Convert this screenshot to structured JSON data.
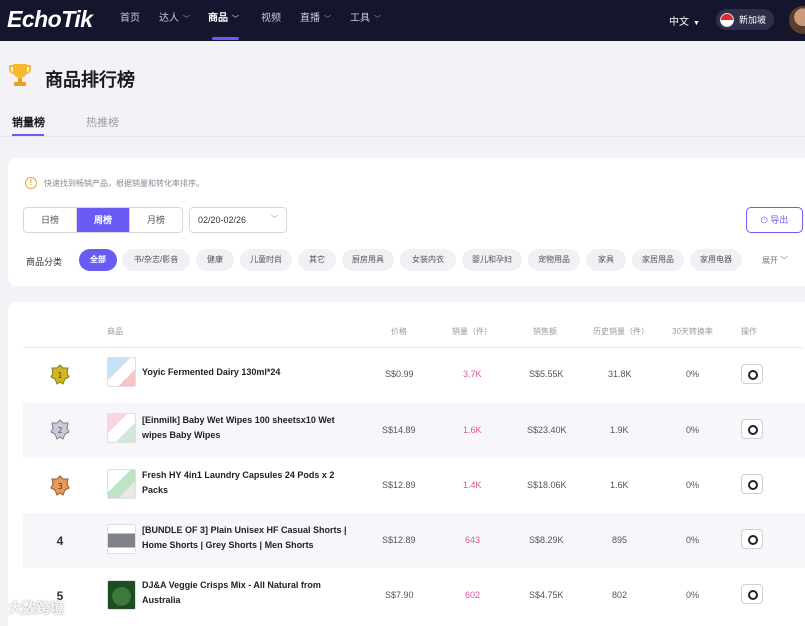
{
  "app": {
    "logo": "EchoTik"
  },
  "nav": {
    "items": [
      {
        "label": "首页"
      },
      {
        "label": "达人"
      },
      {
        "label": "商品"
      },
      {
        "label": "视频"
      },
      {
        "label": "直播"
      },
      {
        "label": "工具"
      }
    ],
    "language": "中文",
    "region": "新加坡"
  },
  "header": {
    "title": "商品排行榜"
  },
  "tabs": [
    {
      "label": "销量榜"
    },
    {
      "label": "热推榜"
    }
  ],
  "filters": {
    "tip": "快速找到畅销产品，根据销量和转化率排序。",
    "periods": [
      {
        "label": "日榜"
      },
      {
        "label": "周榜"
      },
      {
        "label": "月榜"
      }
    ],
    "date_range": "02/20-02/26",
    "export_label": "导出",
    "category_label": "商品分类",
    "categories": [
      {
        "label": "全部"
      },
      {
        "label": "书/杂志/影音"
      },
      {
        "label": "健康"
      },
      {
        "label": "儿童时尚"
      },
      {
        "label": "其它"
      },
      {
        "label": "厨房用具"
      },
      {
        "label": "女装内衣"
      },
      {
        "label": "婴儿和孕妇"
      },
      {
        "label": "宠物用品"
      },
      {
        "label": "家具"
      },
      {
        "label": "家居用品"
      },
      {
        "label": "家用电器"
      }
    ],
    "expand_label": "展开"
  },
  "table": {
    "columns": {
      "product": "商品",
      "price": "价格",
      "sales": "销量（件）",
      "revenue": "销售额",
      "history_sales": "历史销量（件）",
      "conversion": "30天转换率",
      "action": "操作"
    },
    "rows": [
      {
        "rank": "1",
        "name": "Yoyic Fermented Dairy 130ml*24",
        "price": "S$0.99",
        "sales": "3.7K",
        "revenue": "S$5.55K",
        "history": "31.8K",
        "conv": "0%"
      },
      {
        "rank": "2",
        "name": "[Einmilk] Baby Wet Wipes 100 sheetsx10 Wet wipes Baby Wipes",
        "price": "S$14.89",
        "sales": "1.6K",
        "revenue": "S$23.40K",
        "history": "1.9K",
        "conv": "0%"
      },
      {
        "rank": "3",
        "name": "Fresh HY 4in1 Laundry Capsules 24 Pods x 2 Packs",
        "price": "S$12.89",
        "sales": "1.4K",
        "revenue": "S$18.06K",
        "history": "1.6K",
        "conv": "0%"
      },
      {
        "rank": "4",
        "name": "[BUNDLE OF 3] Plain Unisex HF Casual Shorts | Home Shorts | Grey Shorts | Men Shorts",
        "price": "S$12.89",
        "sales": "643",
        "revenue": "S$8.29K",
        "history": "895",
        "conv": "0%"
      },
      {
        "rank": "5",
        "name": "DJ&A Veggie Crisps Mix - All Natural from Australia",
        "price": "S$7.90",
        "sales": "602",
        "revenue": "S$4.75K",
        "history": "802",
        "conv": "0%"
      }
    ]
  },
  "watermark": "大数跨境",
  "colors": {
    "accent": "#6a5cf3",
    "sales_pink": "#e0559a",
    "nav_bg": "#15162e"
  }
}
